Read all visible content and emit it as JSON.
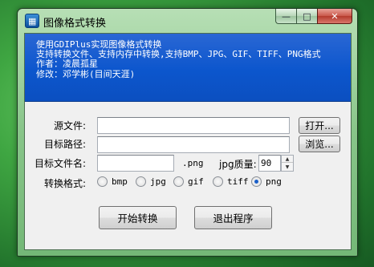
{
  "window": {
    "title": "图像格式转换",
    "app_icon_glyph": "▦",
    "caption": {
      "minimize": "—",
      "maximize": "□",
      "close": "✕"
    }
  },
  "banner": {
    "lines": [
      "使用GDIPlus实现图像格式转换",
      "支持转换文件、支持内存中转换,支持BMP、JPG、GIF、TIFF、PNG格式",
      "作者：凌晨孤星",
      "修改：邓学彬(目间天涯)"
    ]
  },
  "form": {
    "source_label": "源文件:",
    "source_value": "",
    "open_button": "打开...",
    "target_path_label": "目标路径:",
    "target_path_value": "",
    "browse_button": "浏览...",
    "target_name_label": "目标文件名:",
    "target_name_value": "",
    "extension": ".png",
    "quality_label": "jpg质量:",
    "quality_value": "90",
    "format_label": "转换格式:",
    "formats": [
      {
        "label": "bmp",
        "checked": false
      },
      {
        "label": "jpg",
        "checked": false
      },
      {
        "label": "gif",
        "checked": false
      },
      {
        "label": "tiff",
        "checked": false
      },
      {
        "label": "png",
        "checked": true
      }
    ],
    "start_button": "开始转换",
    "exit_button": "退出程序"
  },
  "colors": {
    "banner_blue": "#0c56cd",
    "desktop_green": "#3fa642",
    "close_red": "#c9574a",
    "radio_dot": "#1b5fc8"
  }
}
